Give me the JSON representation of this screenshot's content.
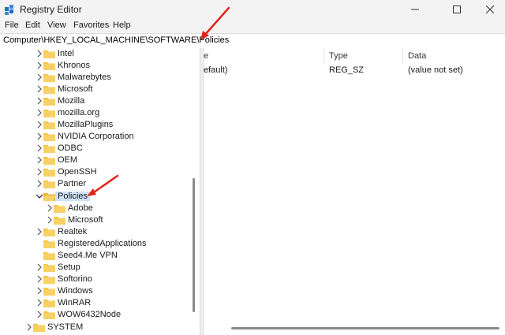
{
  "window": {
    "title": "Registry Editor"
  },
  "menu": [
    "File",
    "Edit",
    "View",
    "Favorites",
    "Help"
  ],
  "address": "Computer\\HKEY_LOCAL_MACHINE\\SOFTWARE\\Policies",
  "tree": {
    "items": [
      "Intel",
      "Khronos",
      "Malwarebytes",
      "Microsoft",
      "Mozilla",
      "mozilla.org",
      "MozillaPlugins",
      "NVIDIA Corporation",
      "ODBC",
      "OEM",
      "OpenSSH",
      "Partner",
      "Policies",
      "Adobe",
      "Microsoft",
      "Realtek",
      "RegisteredApplications",
      "Seed4.Me VPN",
      "Setup",
      "Softorino",
      "Windows",
      "WinRAR",
      "WOW6432Node",
      "SYSTEM"
    ],
    "selected": "Policies"
  },
  "list": {
    "columns": [
      "e",
      "Type",
      "Data"
    ],
    "rows": [
      {
        "name": "efault)",
        "type": "REG_SZ",
        "data": "(value not set)"
      }
    ]
  },
  "colors": {
    "accent": "#0a63b5",
    "selection": "#cfe3f7",
    "folder": "#f5c542",
    "arrow": "#e0251b"
  }
}
